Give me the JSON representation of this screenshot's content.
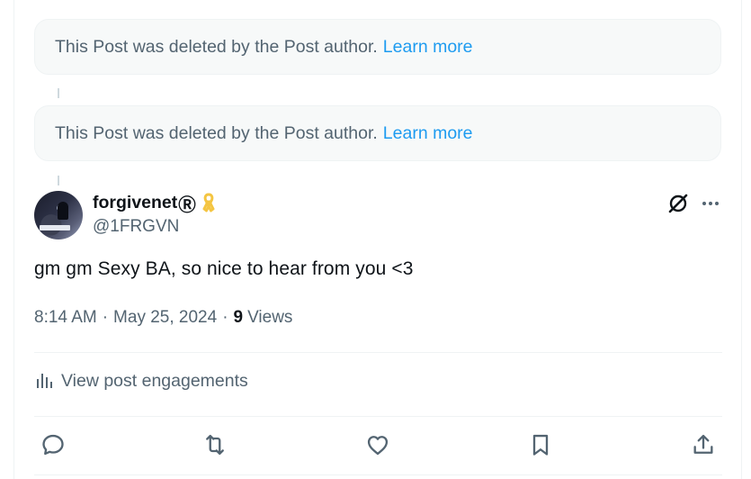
{
  "deleted_notice": {
    "text": "This Post was deleted by the Post author.",
    "link": "Learn more"
  },
  "post": {
    "author": {
      "display_name": "forgivenet",
      "name_suffix": "Ⓡ",
      "badge_icon": "yellow-ribbon-icon",
      "handle": "@1FRGVN"
    },
    "text": "gm gm Sexy BA, so nice to hear from you <3",
    "time": "8:14 AM",
    "date": "May 25, 2024",
    "views_count": "9",
    "views_label": "Views",
    "engagements_label": "View post engagements"
  },
  "header_icons": [
    "grok-icon",
    "more-icon"
  ],
  "actions": [
    "reply-icon",
    "repost-icon",
    "like-icon",
    "bookmark-icon",
    "share-icon"
  ],
  "colors": {
    "accent": "#1d9bf0",
    "text": "#0f1419",
    "secondary": "#536471",
    "ribbon": "#f4c542"
  }
}
